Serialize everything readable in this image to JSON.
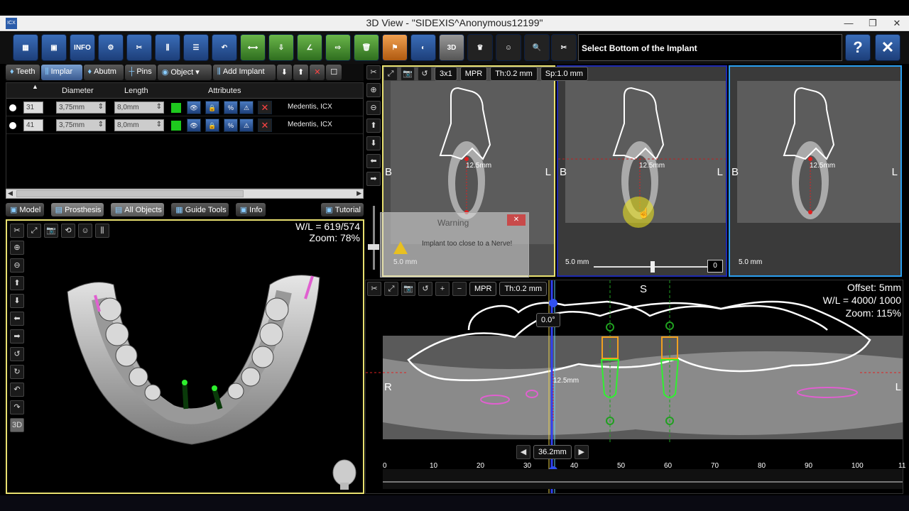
{
  "window": {
    "title": "3D View  -  \"SIDEXIS^Anonymous12199\"",
    "app_icon": "ICX",
    "minimize": "—",
    "restore": "❐",
    "close": "✕"
  },
  "toolbar": {
    "info_label": "INFO",
    "view3d_label": "3D",
    "hint": "Select Bottom of the Implant",
    "help_label": "?",
    "close_label": "✕"
  },
  "tabs": [
    "Teeth",
    "Implar",
    "Abutm",
    "Pins",
    "Object"
  ],
  "add_implant": "Add Implant",
  "implant_table": {
    "columns": [
      "Diameter",
      "Length",
      "Attributes"
    ],
    "rows": [
      {
        "tooth": "31",
        "diameter": "3,75mm",
        "length": "8,0mm",
        "manufacturer": "Medentis, ICX",
        "color": "#1ec81e"
      },
      {
        "tooth": "41",
        "diameter": "3,75mm",
        "length": "8,0mm",
        "manufacturer": "Medentis, ICX",
        "color": "#1ec81e"
      }
    ]
  },
  "view_tabs": [
    "Model",
    "Prosthesis",
    "All Objects",
    "Guide Tools",
    "Info",
    "Tutorial"
  ],
  "view3d": {
    "wl": "W/L = 619/574",
    "zoom": "Zoom: 78%",
    "mode_label": "3D"
  },
  "mpr_toolbar": {
    "layout": "3x1",
    "mpr": "MPR",
    "thickness": "Th:0.2 mm",
    "spacing": "Sp:1.0 mm"
  },
  "slices": {
    "orient_left": "B",
    "orient_right": "L",
    "measurement": "12.5mm",
    "scale": "5.0 mm",
    "slider_value": "0"
  },
  "warning": {
    "title": "Warning",
    "message": "Implant too close to a Nerve!",
    "close": "✕"
  },
  "panorama": {
    "mpr": "MPR",
    "thickness": "Th:0.2 mm",
    "top_label": "S",
    "left_label": "R",
    "right_label": "L",
    "offset": "Offset: 5mm",
    "wl": "W/L = 4000/ 1000",
    "zoom": "Zoom: 115%",
    "angle": "0.0°",
    "measurement": "12.5mm",
    "position": "36.2mm",
    "ruler_ticks": [
      "0",
      "10",
      "20",
      "30",
      "40",
      "50",
      "60",
      "70",
      "80",
      "90",
      "100",
      "11"
    ]
  }
}
